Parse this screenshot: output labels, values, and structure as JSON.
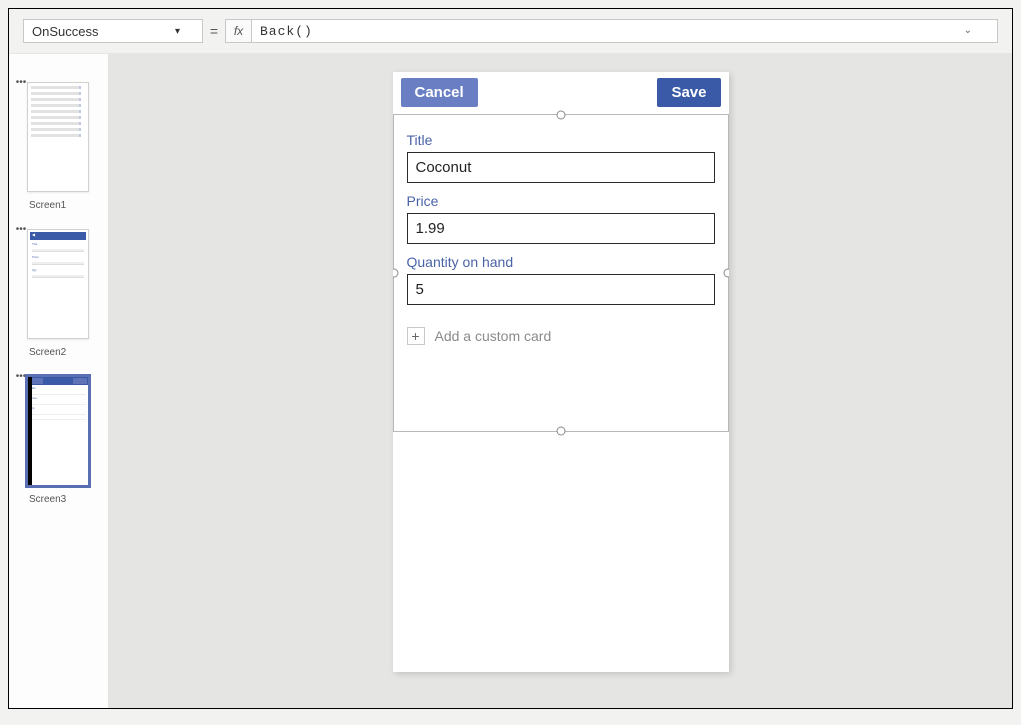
{
  "formula_bar": {
    "property": "OnSuccess",
    "equals": "=",
    "fx_symbol": "fx",
    "formula": "Back()"
  },
  "screens_panel": {
    "items": [
      {
        "label": "Screen1"
      },
      {
        "label": "Screen2"
      },
      {
        "label": "Screen3"
      }
    ],
    "selected_index": 2
  },
  "app": {
    "cancel_label": "Cancel",
    "save_label": "Save",
    "fields": {
      "title": {
        "label": "Title",
        "value": "Coconut"
      },
      "price": {
        "label": "Price",
        "value": "1.99"
      },
      "qty": {
        "label": "Quantity on hand",
        "value": "5"
      }
    },
    "add_card_label": "Add a custom card"
  }
}
